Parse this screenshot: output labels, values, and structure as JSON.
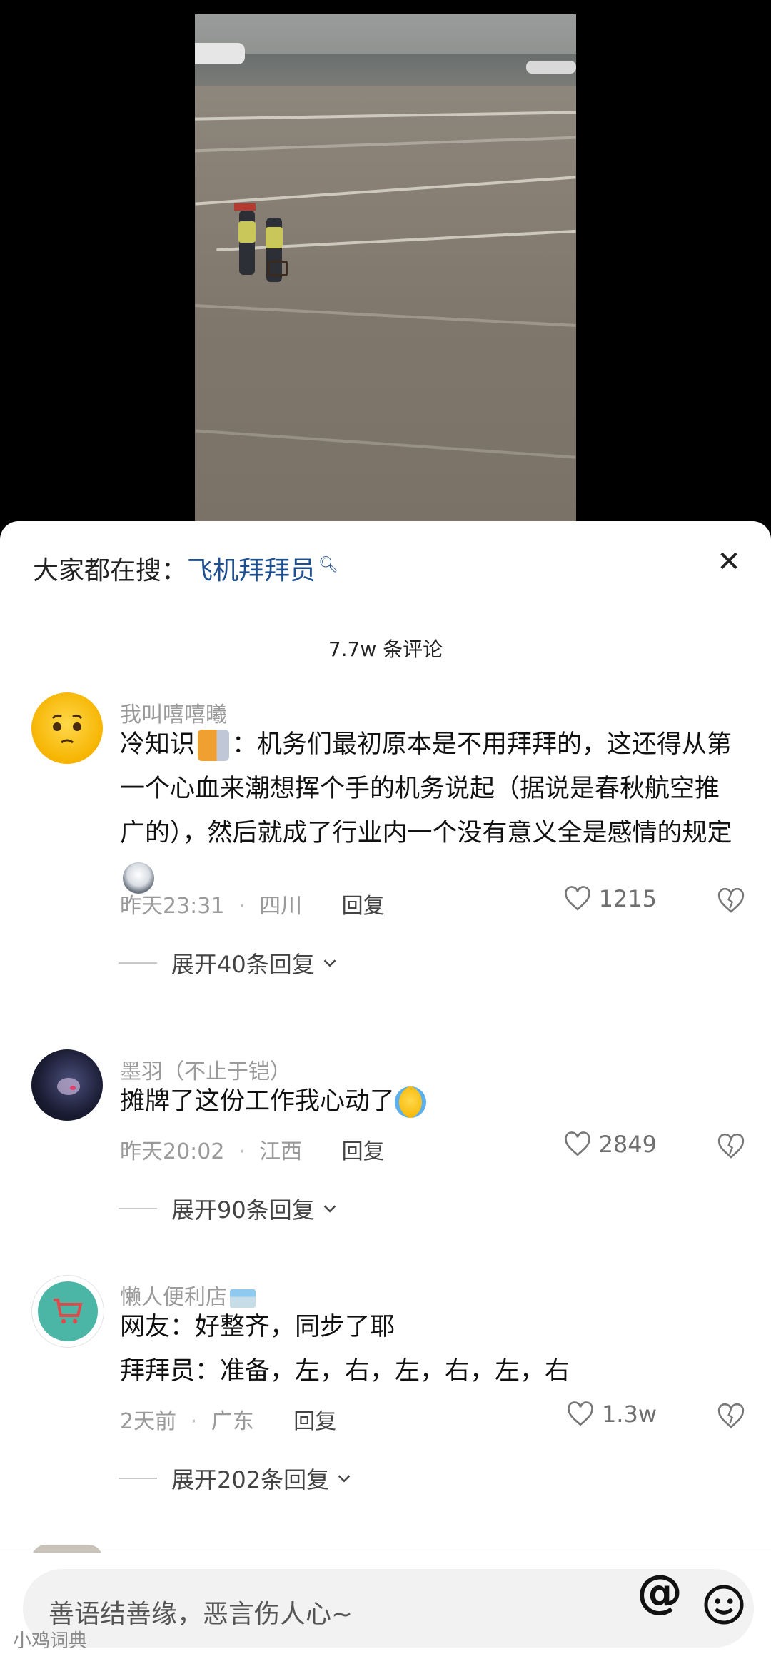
{
  "header": {
    "search_prefix": "大家都在搜：",
    "search_keyword": "飞机拜拜员",
    "comment_count": "7.7w 条评论"
  },
  "comments": [
    {
      "nickname": "我叫嘻嘻曦",
      "text_line1": "冷知识",
      "text_rest": "：机务们最初原本是不用拜拜的，这还得从第一个心血来潮想挥个手的机务说起（据说是春秋航空推广的），然后就成了行业内一个没有意义全是感情的规定",
      "time": "昨天23:31",
      "location": "四川",
      "reply_label": "回复",
      "likes": "1215",
      "expand_label": "展开40条回复"
    },
    {
      "nickname": "墨羽（不止于铠）",
      "text": "摊牌了这份工作我心动了",
      "time": "昨天20:02",
      "location": "江西",
      "reply_label": "回复",
      "likes": "2849",
      "expand_label": "展开90条回复"
    },
    {
      "nickname": "懒人便利店",
      "text_line1": "网友：好整齐，同步了耶",
      "text_line2": "拜拜员：准备，左，右，左，右，左，右",
      "time": "2天前",
      "location": "广东",
      "reply_label": "回复",
      "likes": "1.3w",
      "expand_label": "展开202条回复"
    }
  ],
  "input": {
    "placeholder": "善语结善缘，恶言伤人心~"
  },
  "watermark": "小鸡词典",
  "icons": {
    "close": "close-icon",
    "heart": "heart-icon",
    "broken_heart": "broken-heart-icon",
    "at": "at-icon",
    "emoji": "emoji-face-icon",
    "search": "search-icon"
  }
}
